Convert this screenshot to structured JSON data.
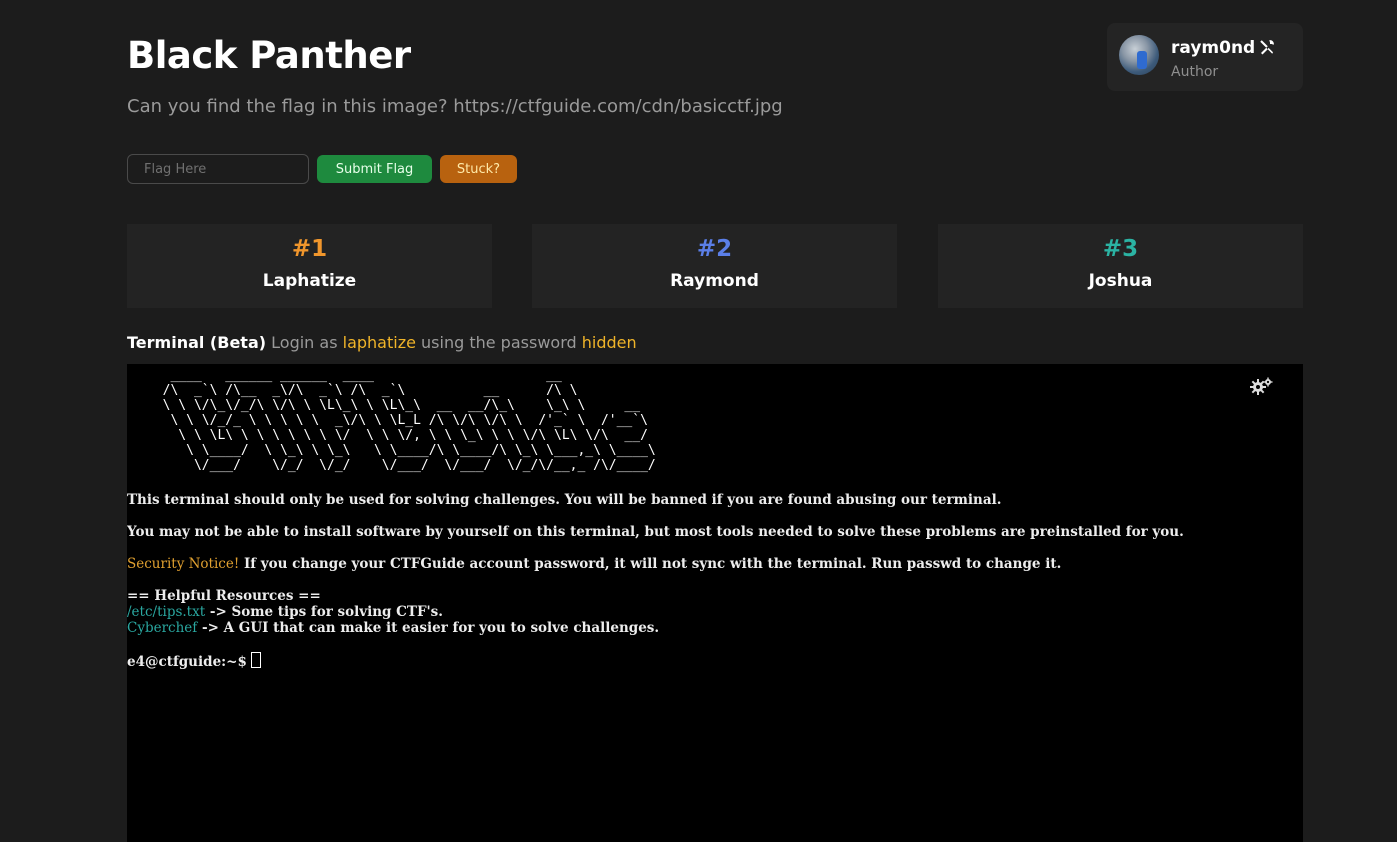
{
  "challenge": {
    "title": "Black Panther",
    "description": "Can you find the flag in this image? https://ctfguide.com/cdn/basicctf.jpg"
  },
  "author": {
    "name": "raym0nd",
    "role": "Author",
    "badge_icon": "tools-icon"
  },
  "flag_form": {
    "placeholder": "Flag Here",
    "value": "",
    "submit_label": "Submit Flag",
    "stuck_label": "Stuck?"
  },
  "leaderboard": [
    {
      "rank": "#1",
      "name": "Laphatize",
      "color": "#f0962c"
    },
    {
      "rank": "#2",
      "name": "Raymond",
      "color": "#5b7fe8"
    },
    {
      "rank": "#3",
      "name": "Joshua",
      "color": "#2bb3a3"
    }
  ],
  "terminal_info": {
    "label": "Terminal (Beta)",
    "login_prefix": "Login as",
    "username": "laphatize",
    "password_prefix": "using the password",
    "password": "hidden"
  },
  "terminal": {
    "banner": "   ____   ______ ______  ____                      __\n  /\\  _`\\ /\\__  _\\/\\  _`\\ /\\  _`\\          __      /\\ \\\n  \\ \\ \\/\\_\\/_/\\ \\/\\ \\ \\L\\_\\ \\ \\L\\_\\  __  __/\\_\\    \\_\\ \\     __\n   \\ \\ \\/_/_ \\ \\ \\ \\ \\  _\\/\\ \\ \\L_L /\\ \\/\\ \\/\\ \\  /'_` \\  /'__`\\\n    \\ \\ \\L\\ \\ \\ \\ \\ \\ \\ \\/  \\ \\ \\/, \\ \\ \\_\\ \\ \\ \\/\\ \\L\\ \\/\\  __/\n     \\ \\____/  \\ \\_\\ \\ \\_\\   \\ \\____/\\ \\____/\\ \\_\\ \\___,_\\ \\____\\\n      \\/___/    \\/_/  \\/_/    \\/___/  \\/___/  \\/_/\\/__,_ /\\/____/",
    "warning": "This terminal should only be used for solving challenges. You will be banned if you are found abusing our terminal.",
    "software_note": "You may not be able to install software by yourself on this terminal, but most tools needed to solve these problems are preinstalled for you.",
    "security_label": "Security Notice!",
    "security_text": " If you change your CTFGuide account password, it will not sync with the terminal. Run passwd to change it.",
    "resources_header": "== Helpful Resources ==",
    "resources": [
      {
        "name": "/etc/tips.txt",
        "desc": " -> Some tips for solving CTF's."
      },
      {
        "name": "Cyberchef",
        "desc": " -> A GUI that can make it easier for you to solve challenges."
      }
    ],
    "prompt": "e4@ctfguide:~$"
  }
}
